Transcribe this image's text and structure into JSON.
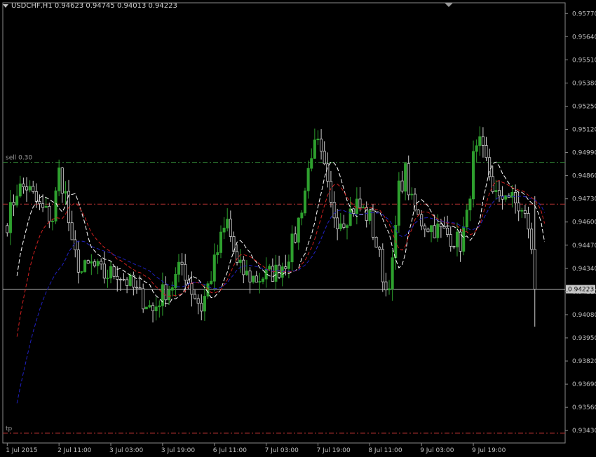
{
  "header": {
    "symbol": "USDCHF,H1",
    "open": "0.94623",
    "high": "0.94745",
    "low": "0.94013",
    "close": "0.94223"
  },
  "chart_data": {
    "type": "candlestick",
    "ylim": [
      0.9336,
      0.9583
    ],
    "y_ticks": [
      "0.95770",
      "0.95640",
      "0.95510",
      "0.95380",
      "0.95250",
      "0.95120",
      "0.94990",
      "0.94860",
      "0.94730",
      "0.94600",
      "0.94470",
      "0.94340",
      "0.94210",
      "0.94080",
      "0.93950",
      "0.93820",
      "0.93690",
      "0.93560",
      "0.93430"
    ],
    "x_ticks": [
      "1 Jul 2015",
      "2 Jul 11:00",
      "3 Jul 03:00",
      "3 Jul 19:00",
      "6 Jul 11:00",
      "7 Jul 03:00",
      "7 Jul 19:00",
      "8 Jul 11:00",
      "9 Jul 03:00",
      "9 Jul 19:00"
    ],
    "current_price": "0.94223",
    "levels": [
      {
        "label": "sell 0.30",
        "price": 0.94935,
        "color": "#2e7d32",
        "style": "dash-dot"
      },
      {
        "label": "",
        "price": 0.947,
        "color": "#b03030",
        "style": "dash-dot"
      },
      {
        "label": "tp",
        "price": 0.93415,
        "color": "#b03030",
        "style": "dash-dot"
      }
    ],
    "candle_anchors": [
      [
        0,
        0.946
      ],
      [
        3,
        0.9478
      ],
      [
        6,
        0.948
      ],
      [
        10,
        0.9468
      ],
      [
        14,
        0.9462
      ],
      [
        16,
        0.9488
      ],
      [
        18,
        0.9475
      ],
      [
        20,
        0.9445
      ],
      [
        23,
        0.9432
      ],
      [
        26,
        0.9436
      ],
      [
        30,
        0.943
      ],
      [
        34,
        0.9432
      ],
      [
        38,
        0.9425
      ],
      [
        41,
        0.9418
      ],
      [
        43,
        0.9415
      ],
      [
        45,
        0.941
      ],
      [
        48,
        0.942
      ],
      [
        51,
        0.9425
      ],
      [
        54,
        0.9436
      ],
      [
        57,
        0.9422
      ],
      [
        60,
        0.9412
      ],
      [
        63,
        0.943
      ],
      [
        66,
        0.945
      ],
      [
        68,
        0.946
      ],
      [
        71,
        0.9435
      ],
      [
        74,
        0.943
      ],
      [
        77,
        0.9428
      ],
      [
        80,
        0.943
      ],
      [
        83,
        0.9432
      ],
      [
        86,
        0.9438
      ],
      [
        89,
        0.9452
      ],
      [
        92,
        0.9478
      ],
      [
        94,
        0.95
      ],
      [
        96,
        0.9502
      ],
      [
        98,
        0.9488
      ],
      [
        100,
        0.9468
      ],
      [
        102,
        0.9462
      ],
      [
        104,
        0.9462
      ],
      [
        108,
        0.947
      ],
      [
        112,
        0.9462
      ],
      [
        115,
        0.944
      ],
      [
        117,
        0.9422
      ],
      [
        119,
        0.9435
      ],
      [
        121,
        0.9478
      ],
      [
        123,
        0.9488
      ],
      [
        125,
        0.947
      ],
      [
        127,
        0.9462
      ],
      [
        130,
        0.9458
      ],
      [
        134,
        0.9455
      ],
      [
        137,
        0.9452
      ],
      [
        140,
        0.9448
      ],
      [
        142,
        0.9462
      ],
      [
        144,
        0.9495
      ],
      [
        146,
        0.9502
      ],
      [
        148,
        0.9493
      ],
      [
        150,
        0.948
      ],
      [
        152,
        0.947
      ],
      [
        154,
        0.9478
      ],
      [
        156,
        0.9472
      ],
      [
        158,
        0.9468
      ],
      [
        160,
        0.9462
      ],
      [
        161,
        0.9458
      ],
      [
        162,
        0.9442
      ],
      [
        163,
        0.9422
      ]
    ],
    "candle_count": 164,
    "ma_fast_color": "#ffffff",
    "ma_mid_color": "#d02020",
    "ma_slow_color": "#2020c0",
    "bull_color": "#2ea02e",
    "bear_color": "#cfcfcf"
  }
}
